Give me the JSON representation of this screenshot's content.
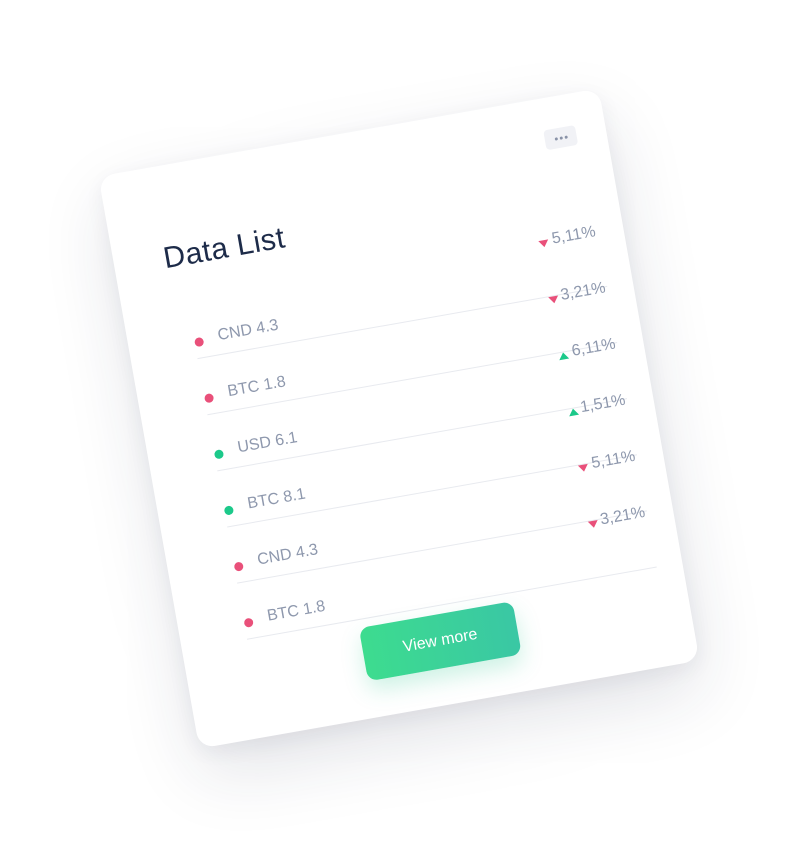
{
  "card": {
    "title": "Data List",
    "menu_icon": "more-horizontal-icon",
    "rows": [
      {
        "label": "CND 4.3",
        "change": "5,11%",
        "trend": "down",
        "color": "#e9507a"
      },
      {
        "label": "BTC 1.8",
        "change": "3,21%",
        "trend": "down",
        "color": "#e9507a"
      },
      {
        "label": "USD 6.1",
        "change": "6,11%",
        "trend": "up",
        "color": "#1cc98a"
      },
      {
        "label": "BTC 8.1",
        "change": "1,51%",
        "trend": "up",
        "color": "#1cc98a"
      },
      {
        "label": "CND 4.3",
        "change": "5,11%",
        "trend": "down",
        "color": "#e9507a"
      },
      {
        "label": "BTC 1.8",
        "change": "3,21%",
        "trend": "down",
        "color": "#e9507a"
      }
    ],
    "view_more_label": "View more",
    "colors": {
      "negative": "#e9507a",
      "positive": "#1cc98a",
      "button_start": "#3ddc8f",
      "button_end": "#3ac7a4"
    }
  }
}
